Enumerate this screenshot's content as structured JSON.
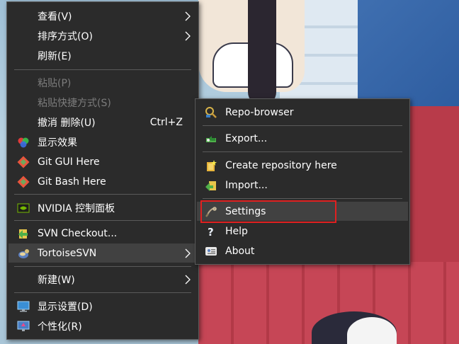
{
  "main_menu": {
    "items": [
      {
        "label": "查看(V)",
        "icon": "none",
        "submenu": true
      },
      {
        "label": "排序方式(O)",
        "icon": "none",
        "submenu": true
      },
      {
        "label": "刷新(E)",
        "icon": "none"
      },
      {
        "label": "粘贴(P)",
        "icon": "none",
        "disabled": true
      },
      {
        "label": "粘贴快捷方式(S)",
        "icon": "none",
        "disabled": true
      },
      {
        "label": "撤消 删除(U)",
        "shortcut": "Ctrl+Z",
        "icon": "none"
      },
      {
        "label": "显示效果",
        "icon": "color-wheel-icon"
      },
      {
        "label": "Git GUI Here",
        "icon": "git-icon"
      },
      {
        "label": "Git Bash Here",
        "icon": "git-icon"
      },
      {
        "label": "NVIDIA 控制面板",
        "icon": "nvidia-icon"
      },
      {
        "label": "SVN Checkout...",
        "icon": "svn-checkout-icon"
      },
      {
        "label": "TortoiseSVN",
        "icon": "tortoisesvn-icon",
        "submenu": true,
        "hover": true
      },
      {
        "label": "新建(W)",
        "icon": "none",
        "submenu": true
      },
      {
        "label": "显示设置(D)",
        "icon": "display-settings-icon"
      },
      {
        "label": "个性化(R)",
        "icon": "personalize-icon"
      }
    ]
  },
  "tortoise_submenu": {
    "items": [
      {
        "label": "Repo-browser",
        "icon": "repo-browser-icon"
      },
      {
        "label": "Export...",
        "icon": "export-icon"
      },
      {
        "label": "Create repository here",
        "icon": "create-repo-icon"
      },
      {
        "label": "Import...",
        "icon": "import-icon"
      },
      {
        "label": "Settings",
        "icon": "settings-icon",
        "hover": true,
        "highlighted": true
      },
      {
        "label": "Help",
        "icon": "help-icon"
      },
      {
        "label": "About",
        "icon": "about-icon"
      }
    ]
  },
  "colors": {
    "menu_bg": "#2b2b2b",
    "hover_bg": "#414141",
    "disabled_text": "#7c7c7c",
    "highlight_border": "#e02020"
  }
}
